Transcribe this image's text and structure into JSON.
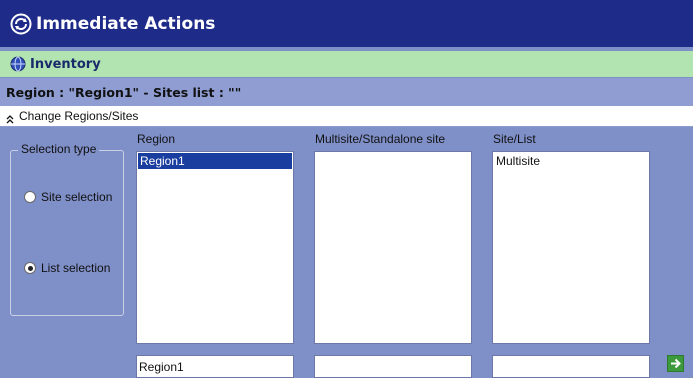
{
  "titlebar": {
    "title": "Immediate Actions"
  },
  "breadcrumb": {
    "label": "Inventory"
  },
  "context": {
    "text": "Region : \"Region1\" - Sites list : \"\""
  },
  "toggle": {
    "label": "Change Regions/Sites"
  },
  "selection_type": {
    "legend": "Selection type",
    "options": [
      {
        "label": "Site selection",
        "checked": false
      },
      {
        "label": "List selection",
        "checked": true
      }
    ]
  },
  "columns": {
    "region": {
      "header": "Region",
      "items": [
        "Region1"
      ],
      "selected": "Region1",
      "input_value": "Region1"
    },
    "multisite": {
      "header": "Multisite/Standalone site",
      "items": [],
      "input_value": ""
    },
    "sitelist": {
      "header": "Site/List",
      "items": [
        "Multisite"
      ],
      "input_value": ""
    }
  },
  "colors": {
    "title_bg": "#1f2b89",
    "inventory_bg": "#b1e4b1",
    "panel_bg": "#7f8fc8",
    "selection": "#1a3ea0",
    "go_button": "#3c9a3c"
  }
}
